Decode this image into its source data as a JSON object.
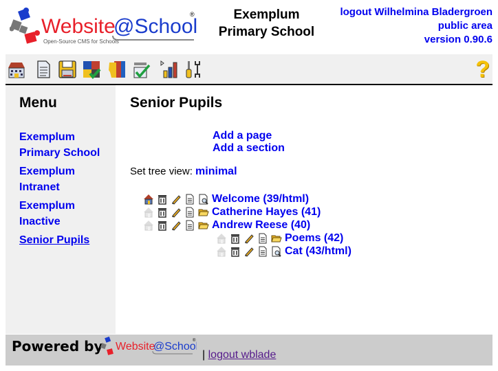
{
  "header": {
    "logo_text": "Website@School",
    "logo_tagline": "Open-Source CMS for Schools",
    "site_title_line1": "Exemplum",
    "site_title_line2": "Primary School",
    "logout_link": "logout Wilhelmina Bladergroen",
    "area_link": "public area",
    "version_link": "version 0.90.6"
  },
  "toolbar": {
    "icons": [
      "start-icon",
      "pages-icon",
      "files-icon",
      "modules-icon",
      "accounts-icon",
      "configuration-icon",
      "statistics-icon",
      "tools-icon"
    ],
    "help_label": "?"
  },
  "sidebar": {
    "title": "Menu",
    "items": [
      {
        "label": "Exemplum Primary School"
      },
      {
        "label": "Exemplum Intranet"
      },
      {
        "label": "Exemplum Inactive"
      },
      {
        "label": "Senior Pupils",
        "current": true
      }
    ]
  },
  "main": {
    "title": "Senior Pupils",
    "add_page": "Add a page",
    "add_section": "Add a section",
    "tree_view_label": "Set tree view:",
    "tree_view_value": "minimal",
    "tree": [
      {
        "label": "Welcome (39/html)",
        "type": "page",
        "is_default": true,
        "level": 0
      },
      {
        "label": "Catherine Hayes (41)",
        "type": "section",
        "is_default": false,
        "level": 0
      },
      {
        "label": "Andrew Reese (40)",
        "type": "section",
        "is_default": false,
        "level": 0
      },
      {
        "label": "Poems (42)",
        "type": "section",
        "is_default": false,
        "level": 1
      },
      {
        "label": "Cat (43/html)",
        "type": "page",
        "is_default": false,
        "level": 1
      }
    ]
  },
  "footer": {
    "powered_by": "Powered by",
    "logo_text": "Website@School",
    "separator": "|",
    "logout_link": "logout wblade"
  },
  "colors": {
    "link": "#0000ee",
    "visited_link": "#551a8b",
    "sidebar_bg": "#f0f0f0",
    "footer_bg": "#cccccc",
    "logo_red": "#e8202a",
    "logo_blue": "#1a3ccc"
  }
}
